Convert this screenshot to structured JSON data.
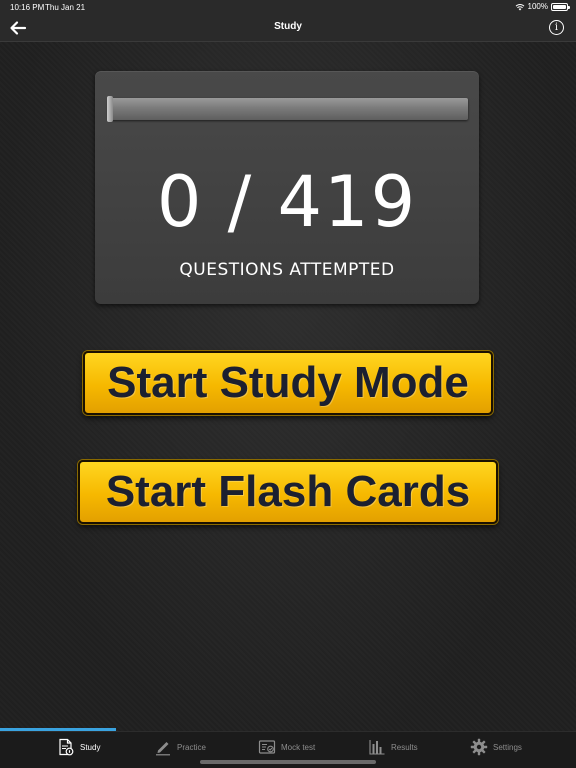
{
  "status_bar": {
    "time": "10:16 PM",
    "date": "Thu Jan 21",
    "battery": "100%"
  },
  "nav": {
    "title": "Study",
    "back_icon": "arrow-left-icon",
    "info_icon": "info-icon",
    "info_glyph": "i"
  },
  "progress": {
    "attempted": 0,
    "total": 419,
    "fraction": 0.0,
    "display": "0 / 419",
    "label": "QUESTIONS ATTEMPTED"
  },
  "buttons": {
    "study_mode": "Start Study Mode",
    "flash_cards": "Start Flash Cards"
  },
  "colors": {
    "button_yellow": "#f6b800",
    "tab_active_indicator": "#3aa3e0"
  },
  "tabs": [
    {
      "label": "Study",
      "icon": "study-doc-icon",
      "active": true
    },
    {
      "label": "Practice",
      "icon": "pencil-icon",
      "active": false
    },
    {
      "label": "Mock test",
      "icon": "mock-test-icon",
      "active": false
    },
    {
      "label": "Results",
      "icon": "bar-chart-icon",
      "active": false
    },
    {
      "label": "Settings",
      "icon": "gear-icon",
      "active": false
    }
  ]
}
